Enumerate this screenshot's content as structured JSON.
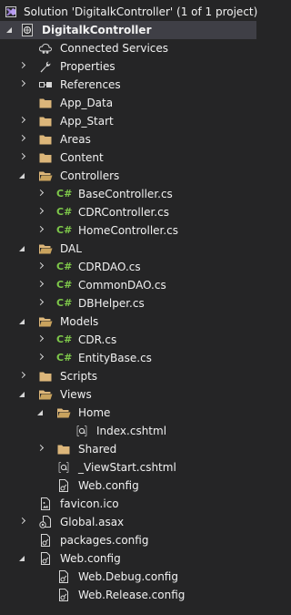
{
  "solution": {
    "label": "Solution 'DigitalkController' (1 of 1 project)",
    "icon": "solution-icon"
  },
  "project": {
    "label": "DigitalkController",
    "icon": "web-project-icon"
  },
  "items": [
    {
      "label": "Connected Services",
      "icon": "connected-services-icon"
    },
    {
      "label": "Properties",
      "icon": "wrench-icon"
    },
    {
      "label": "References",
      "icon": "references-icon"
    },
    {
      "label": "App_Data",
      "icon": "folder-icon"
    },
    {
      "label": "App_Start",
      "icon": "folder-icon"
    },
    {
      "label": "Areas",
      "icon": "folder-icon"
    },
    {
      "label": "Content",
      "icon": "folder-icon"
    },
    {
      "label": "Controllers",
      "icon": "folder-open-icon"
    },
    {
      "label": "BaseController.cs",
      "icon": "csharp-file-icon"
    },
    {
      "label": "CDRController.cs",
      "icon": "csharp-file-icon"
    },
    {
      "label": "HomeController.cs",
      "icon": "csharp-file-icon"
    },
    {
      "label": "DAL",
      "icon": "folder-open-icon"
    },
    {
      "label": "CDRDAO.cs",
      "icon": "csharp-file-icon"
    },
    {
      "label": "CommonDAO.cs",
      "icon": "csharp-file-icon"
    },
    {
      "label": "DBHelper.cs",
      "icon": "csharp-file-icon"
    },
    {
      "label": "Models",
      "icon": "folder-open-icon"
    },
    {
      "label": "CDR.cs",
      "icon": "csharp-file-icon"
    },
    {
      "label": "EntityBase.cs",
      "icon": "csharp-file-icon"
    },
    {
      "label": "Scripts",
      "icon": "folder-icon"
    },
    {
      "label": "Views",
      "icon": "folder-open-icon"
    },
    {
      "label": "Home",
      "icon": "folder-open-icon"
    },
    {
      "label": "Index.cshtml",
      "icon": "razor-file-icon"
    },
    {
      "label": "Shared",
      "icon": "folder-icon"
    },
    {
      "label": "_ViewStart.cshtml",
      "icon": "razor-file-icon"
    },
    {
      "label": "Web.config",
      "icon": "config-file-icon"
    },
    {
      "label": "favicon.ico",
      "icon": "image-file-icon"
    },
    {
      "label": "Global.asax",
      "icon": "global-asax-icon"
    },
    {
      "label": "packages.config",
      "icon": "config-file-icon"
    },
    {
      "label": "Web.config",
      "icon": "config-file-icon"
    },
    {
      "label": "Web.Debug.config",
      "icon": "config-file-icon"
    },
    {
      "label": "Web.Release.config",
      "icon": "config-file-icon"
    }
  ],
  "colors": {
    "background": "#252526",
    "selected_row": "#3f3f46",
    "text": "#f1f1f1",
    "folder": "#dcb67a",
    "csharp": "#7ec84a",
    "solution_accent": "#9b7fd4"
  }
}
